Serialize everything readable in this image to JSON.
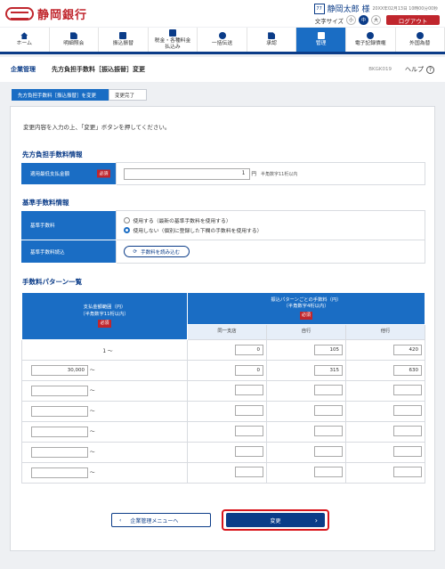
{
  "header": {
    "bank_name": "静岡銀行",
    "user_icon": "77",
    "user_name": "静岡太郎 様",
    "login_time": "20XX年02月13日 10時00分00秒",
    "font_size_label": "文字サイズ",
    "font_sizes": [
      "小",
      "中",
      "大"
    ],
    "logout_label": "ログアウト"
  },
  "nav": [
    {
      "label": "ホーム",
      "icon": "house-icon"
    },
    {
      "label": "明細照会",
      "icon": "document-icon"
    },
    {
      "label": "振込振替",
      "icon": "transfer-icon"
    },
    {
      "label": "税金・各種料金\n払込み",
      "icon": "tax-payment-icon"
    },
    {
      "label": "一括伝送",
      "icon": "batch-transfer-icon"
    },
    {
      "label": "承認",
      "icon": "approval-icon"
    },
    {
      "label": "管理",
      "icon": "settings-icon"
    },
    {
      "label": "電子記録債権",
      "icon": "e-bond-icon"
    },
    {
      "label": "外国為替",
      "icon": "forex-icon"
    }
  ],
  "title": {
    "category": "企業管理",
    "main": "先方負担手数料［振込振替］変更",
    "screen_id": "BKGK019",
    "help_label": "ヘルプ",
    "help_icon": "?"
  },
  "steps": [
    "先方負担手数料［振込振替］を変更",
    "変更完了"
  ],
  "instruction": "変更内容を入力の上、「変更」ボタンを押してください。",
  "section1": {
    "heading": "先方負担手数料情報",
    "label": "適用最低支払金額",
    "required": "必須",
    "value": "1",
    "unit": "円",
    "hint": "半角数字11桁以内"
  },
  "section2": {
    "heading": "基準手数料情報",
    "fee_label": "基準手数料",
    "option_use": "使用する（最新の基準手数料を使用する）",
    "option_nouse": "使用しない（個別に登録した下欄の手数料を使用する）",
    "load_label": "基準手数料読込",
    "load_button": "手数料を読み込む"
  },
  "section3": {
    "heading": "手数料パターン一覧",
    "col_range": "支払金額範囲（円）\n（半角数字11桁以内）",
    "col_fee": "振込パターンごとの手数料（円）\n（半角数字4桁以内）",
    "required": "必須",
    "sub_cols": [
      "同一支店",
      "自行",
      "他行"
    ],
    "tilde": "～",
    "rows": [
      {
        "from": "1",
        "same_branch": "0",
        "own_bank": "105",
        "other_bank": "420"
      },
      {
        "from": "30,000",
        "same_branch": "0",
        "own_bank": "315",
        "other_bank": "630"
      },
      {
        "from": "",
        "same_branch": "",
        "own_bank": "",
        "other_bank": ""
      },
      {
        "from": "",
        "same_branch": "",
        "own_bank": "",
        "other_bank": ""
      },
      {
        "from": "",
        "same_branch": "",
        "own_bank": "",
        "other_bank": ""
      },
      {
        "from": "",
        "same_branch": "",
        "own_bank": "",
        "other_bank": ""
      },
      {
        "from": "",
        "same_branch": "",
        "own_bank": "",
        "other_bank": ""
      }
    ]
  },
  "buttons": {
    "back": "企業管理メニューへ",
    "submit": "変更"
  }
}
